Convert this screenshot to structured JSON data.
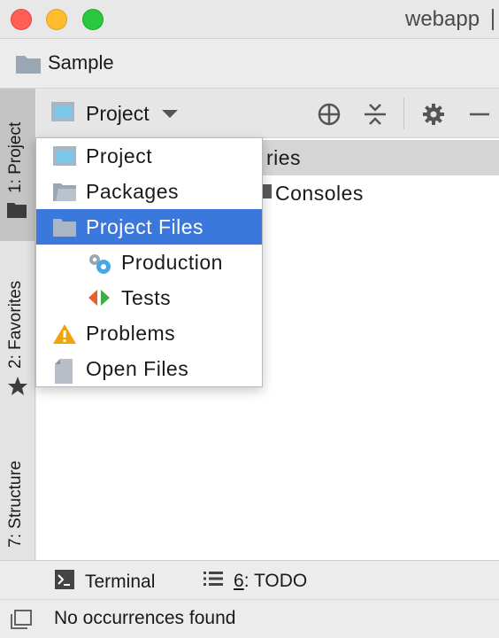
{
  "window": {
    "title": "webapp"
  },
  "navbar": {
    "breadcrumb": "Sample"
  },
  "left_stripe": {
    "tabs": [
      {
        "label": "1: Project",
        "icon": "folder-icon",
        "active": true
      },
      {
        "label": "2: Favorites",
        "icon": "star-icon",
        "active": false
      },
      {
        "label": "7: Structure",
        "icon": "structure-icon",
        "active": false
      }
    ]
  },
  "toolbar": {
    "view_selector_label": "Project",
    "buttons": [
      "locate-icon",
      "collapse-all-icon",
      "gear-icon",
      "minimize-icon"
    ]
  },
  "tree": {
    "rows": [
      {
        "visible_text": "ries",
        "selected": true
      },
      {
        "visible_text": "Consoles",
        "selected": false
      }
    ]
  },
  "dropdown": {
    "items": [
      {
        "label": "Project",
        "icon": "project-view-icon",
        "selected": false
      },
      {
        "label": "Packages",
        "icon": "packages-icon",
        "selected": false
      },
      {
        "label": "Project Files",
        "icon": "folder-icon",
        "selected": true
      },
      {
        "label": "Production",
        "icon": "production-gears-icon",
        "selected": false
      },
      {
        "label": "Tests",
        "icon": "tests-icon",
        "selected": false
      },
      {
        "label": "Problems",
        "icon": "warning-icon",
        "selected": false
      },
      {
        "label": "Open Files",
        "icon": "file-icon",
        "selected": false
      }
    ]
  },
  "bottom_tools": {
    "terminal_label": "Terminal",
    "todo_number": "6",
    "todo_label": ": TODO"
  },
  "status": {
    "message": "No occurrences found"
  },
  "colors": {
    "selection_blue": "#3b78dc",
    "close": "#fe5f57",
    "minimize": "#febc2e",
    "maximize": "#28c840",
    "warning": "#f0a30a"
  }
}
